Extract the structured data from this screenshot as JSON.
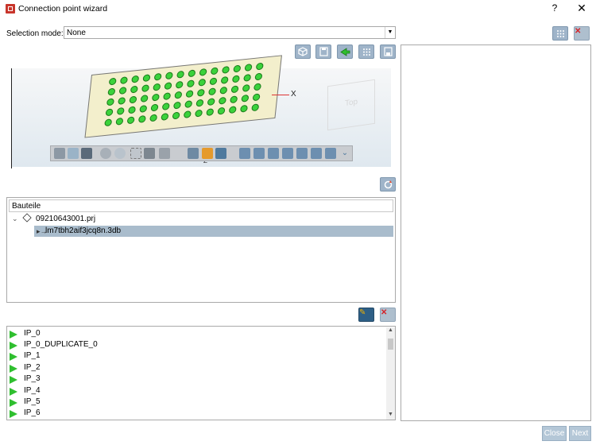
{
  "window": {
    "title": "Connection point wizard",
    "help": "?",
    "close": "✕"
  },
  "selection": {
    "label": "Selection mode:",
    "value": "None"
  },
  "toolbar": {
    "icons": [
      "cube-icon",
      "save-icon",
      "green-arrow-icon",
      "grid-icon",
      "save-alt-icon"
    ]
  },
  "viewport": {
    "x_axis": "X",
    "z_axis": "Z",
    "cube_face": "Top"
  },
  "tree": {
    "header": "Bauteile",
    "project": "09210643001.prj",
    "child": "lm7tbh2aif3jcq8n.3db"
  },
  "ip_list": {
    "items": [
      "IP_0",
      "IP_0_DUPLICATE_0",
      "IP_1",
      "IP_2",
      "IP_3",
      "IP_4",
      "IP_5",
      "IP_6"
    ]
  },
  "footer": {
    "close": "Close",
    "next": "Next"
  },
  "colors": {
    "accent": "#9fb4c9",
    "selected_row": "#a9bccc",
    "ip_icon": "#2fbf2f",
    "danger": "#d4242a"
  }
}
